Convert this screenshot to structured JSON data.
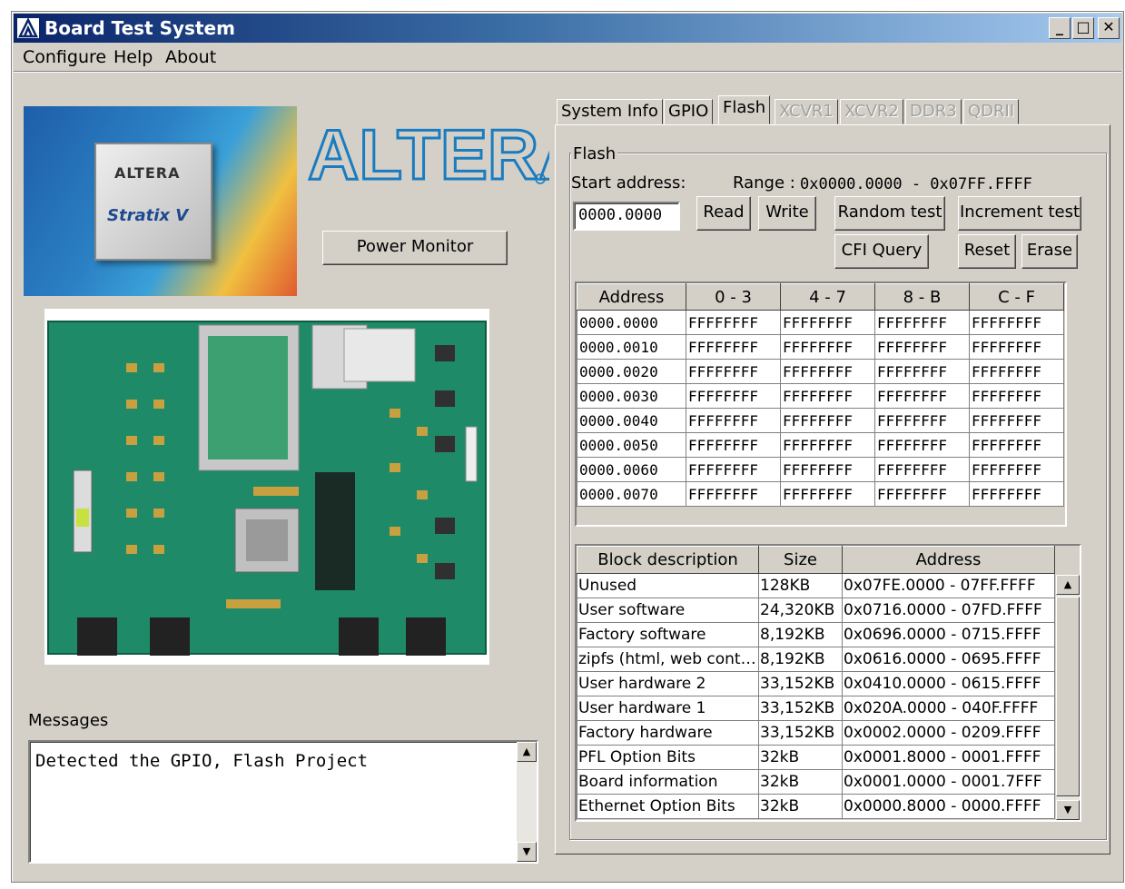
{
  "window": {
    "title": "Board Test System",
    "controls": [
      "minimize",
      "maximize",
      "close"
    ]
  },
  "menu": [
    "Configure",
    "Help",
    "About"
  ],
  "branding": {
    "chip_logo": "ALTERA",
    "chip_family": "Stratix V",
    "logo_text": "ALTERA"
  },
  "buttons": {
    "power_monitor": "Power Monitor"
  },
  "messages": {
    "label": "Messages",
    "text": "Detected the GPIO, Flash Project"
  },
  "tabs": [
    {
      "label": "System Info",
      "state": "normal"
    },
    {
      "label": "GPIO",
      "state": "normal"
    },
    {
      "label": "Flash",
      "state": "active"
    },
    {
      "label": "XCVR1",
      "state": "disabled"
    },
    {
      "label": "XCVR2",
      "state": "disabled"
    },
    {
      "label": "DDR3",
      "state": "disabled"
    },
    {
      "label": "QDRII",
      "state": "disabled"
    }
  ],
  "flash": {
    "group_label": "Flash",
    "start_label": "Start address:",
    "range_label": "Range :",
    "range_value": "0x0000.0000 - 0x07FF.FFFF",
    "start_value": "0000.0000",
    "buttons": {
      "read": "Read",
      "write": "Write",
      "random": "Random test",
      "increment": "Increment test",
      "cfi": "CFI Query",
      "reset": "Reset",
      "erase": "Erase"
    },
    "memory": {
      "headers": [
        "Address",
        "0 - 3",
        "4 - 7",
        "8 - B",
        "C - F"
      ],
      "rows": [
        [
          "0000.0000",
          "FFFFFFFF",
          "FFFFFFFF",
          "FFFFFFFF",
          "FFFFFFFF"
        ],
        [
          "0000.0010",
          "FFFFFFFF",
          "FFFFFFFF",
          "FFFFFFFF",
          "FFFFFFFF"
        ],
        [
          "0000.0020",
          "FFFFFFFF",
          "FFFFFFFF",
          "FFFFFFFF",
          "FFFFFFFF"
        ],
        [
          "0000.0030",
          "FFFFFFFF",
          "FFFFFFFF",
          "FFFFFFFF",
          "FFFFFFFF"
        ],
        [
          "0000.0040",
          "FFFFFFFF",
          "FFFFFFFF",
          "FFFFFFFF",
          "FFFFFFFF"
        ],
        [
          "0000.0050",
          "FFFFFFFF",
          "FFFFFFFF",
          "FFFFFFFF",
          "FFFFFFFF"
        ],
        [
          "0000.0060",
          "FFFFFFFF",
          "FFFFFFFF",
          "FFFFFFFF",
          "FFFFFFFF"
        ],
        [
          "0000.0070",
          "FFFFFFFF",
          "FFFFFFFF",
          "FFFFFFFF",
          "FFFFFFFF"
        ]
      ]
    },
    "blocks": {
      "headers": [
        "Block description",
        "Size",
        "Address"
      ],
      "rows": [
        [
          "Unused",
          "128KB",
          "0x07FE.0000 - 07FF.FFFF"
        ],
        [
          "User software",
          "24,320KB",
          "0x0716.0000 - 07FD.FFFF"
        ],
        [
          "Factory software",
          "8,192KB",
          "0x0696.0000 - 0715.FFFF"
        ],
        [
          "zipfs (html, web cont…",
          "8,192KB",
          "0x0616.0000 - 0695.FFFF"
        ],
        [
          "User hardware 2",
          "33,152KB",
          "0x0410.0000 - 0615.FFFF"
        ],
        [
          "User hardware 1",
          "33,152KB",
          "0x020A.0000 - 040F.FFFF"
        ],
        [
          "Factory hardware",
          "33,152KB",
          "0x0002.0000 - 0209.FFFF"
        ],
        [
          "PFL Option Bits",
          "32kB",
          "0x0001.8000 - 0001.FFFF"
        ],
        [
          "Board information",
          "32kB",
          "0x0001.0000 - 0001.7FFF"
        ],
        [
          "Ethernet Option Bits",
          "32kB",
          "0x0000.8000 - 0000.FFFF"
        ]
      ]
    }
  }
}
